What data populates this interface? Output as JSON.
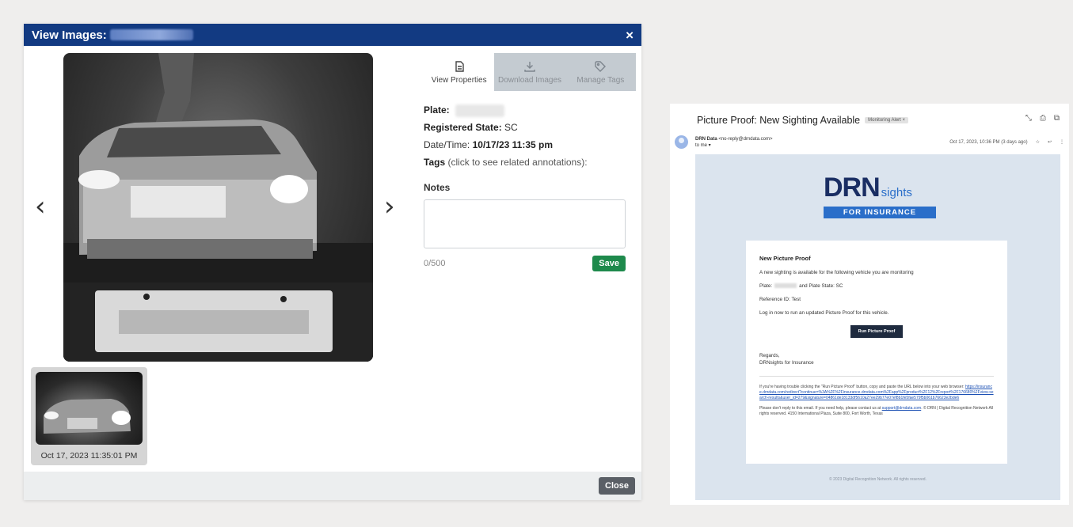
{
  "modal": {
    "title": "View Images:",
    "close_icon": "×",
    "prev_arrow": "‹",
    "next_arrow": "›",
    "thumbnail_caption": "Oct 17, 2023 11:35:01 PM",
    "tabs": [
      {
        "label": "View Properties",
        "icon": "document-icon"
      },
      {
        "label": "Download Images",
        "icon": "download-icon"
      },
      {
        "label": "Manage Tags",
        "icon": "tag-icon"
      }
    ],
    "properties": {
      "plate_label": "Plate:",
      "state_label": "Registered State:",
      "state_value": "SC",
      "datetime_label": "Date/Time:",
      "datetime_value": "10/17/23 11:35 pm",
      "tags_label": "Tags",
      "tags_hint": "(click to see related annotations):"
    },
    "notes": {
      "label": "Notes",
      "counter": "0/500",
      "save_label": "Save"
    },
    "close_label": "Close"
  },
  "email": {
    "subject": "Picture Proof: New Sighting Available",
    "label_badge": "Monitoring Alert ×",
    "sender_name": "DRN Data",
    "sender_email": "<no-reply@drndata.com>",
    "to": "to me ▾",
    "date": "Oct 17, 2023, 10:36 PM (3 days ago)",
    "logo_main": "DRN",
    "logo_sub": "sights",
    "logo_bar": "FOR INSURANCE",
    "card_title": "New Picture Proof",
    "intro": "A new sighting is available for the following vehicle you are monitoring",
    "plate_prefix": "Plate:",
    "plate_suffix": "and Plate State: SC",
    "reference": "Reference ID: Test",
    "login": "Log in now to run an updated Picture Proof for this vehicle.",
    "button": "Run Picture Proof",
    "regards": "Regards,",
    "signoff": "DRNsights for Insurance",
    "trouble_text": "If you're having trouble clicking the \"Run Picture Proof\" button, copy and paste the URL below into your web browser:",
    "url": "https://insurance.drndata.com/redirect?continue=%3A%2F%2Finsurance.drndata.com%2Fapp%2Fproduct%2F12%2Freport%2F176680%2Fview-search-results&user_id=279&signature=04861de18133df5610a27ee29b77e07ef8b1fe5fae579f5b061b76623e2bde6",
    "contact_text": "Please don't reply to this email. If you need help, please contact us at",
    "contact_email": "support@drndata.com",
    "legal": ". © DRN | Digital Recognition Network All rights reserved. 4150 International Plaza, Suite 800, Fort Worth, Texas",
    "copyright": "© 2023 Digital Recognition Network. All rights reserved."
  }
}
